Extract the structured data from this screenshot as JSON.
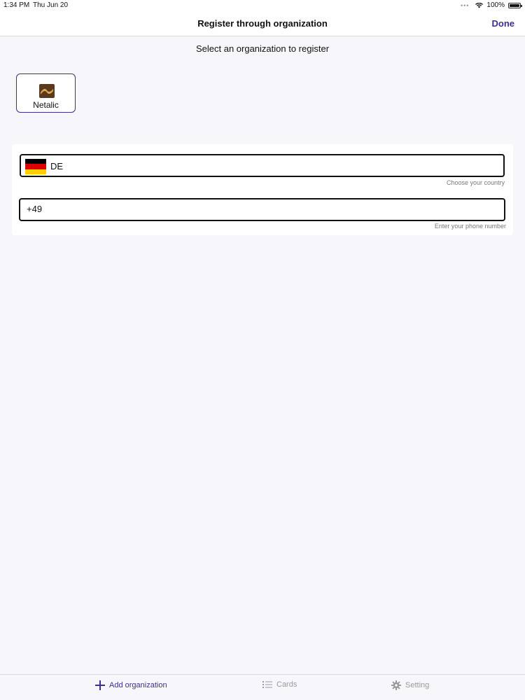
{
  "status_bar": {
    "time": "1:34 PM",
    "date": "Thu Jun 20",
    "battery": "100%",
    "battery_level": 1.0
  },
  "nav": {
    "title": "Register through organization",
    "done_label": "Done"
  },
  "subtitle": "Select an organization to register",
  "organizations": [
    {
      "name": "Netalic",
      "logo_icon": "netalic-logo-icon"
    }
  ],
  "form": {
    "country": {
      "value": "DE",
      "flag_icon": "germany-flag-icon",
      "helper": "Choose your country"
    },
    "phone": {
      "value": "+49",
      "helper": "Enter your phone number"
    }
  },
  "tabs": [
    {
      "label": "Add organization",
      "icon": "plus-icon",
      "active": true
    },
    {
      "label": "Cards",
      "icon": "list-icon",
      "active": false
    },
    {
      "label": "Setting",
      "icon": "gear-icon",
      "active": false
    }
  ],
  "colors": {
    "accent": "#3b2f8f",
    "inactive_tab": "#999999",
    "background": "#f7f6fa"
  }
}
